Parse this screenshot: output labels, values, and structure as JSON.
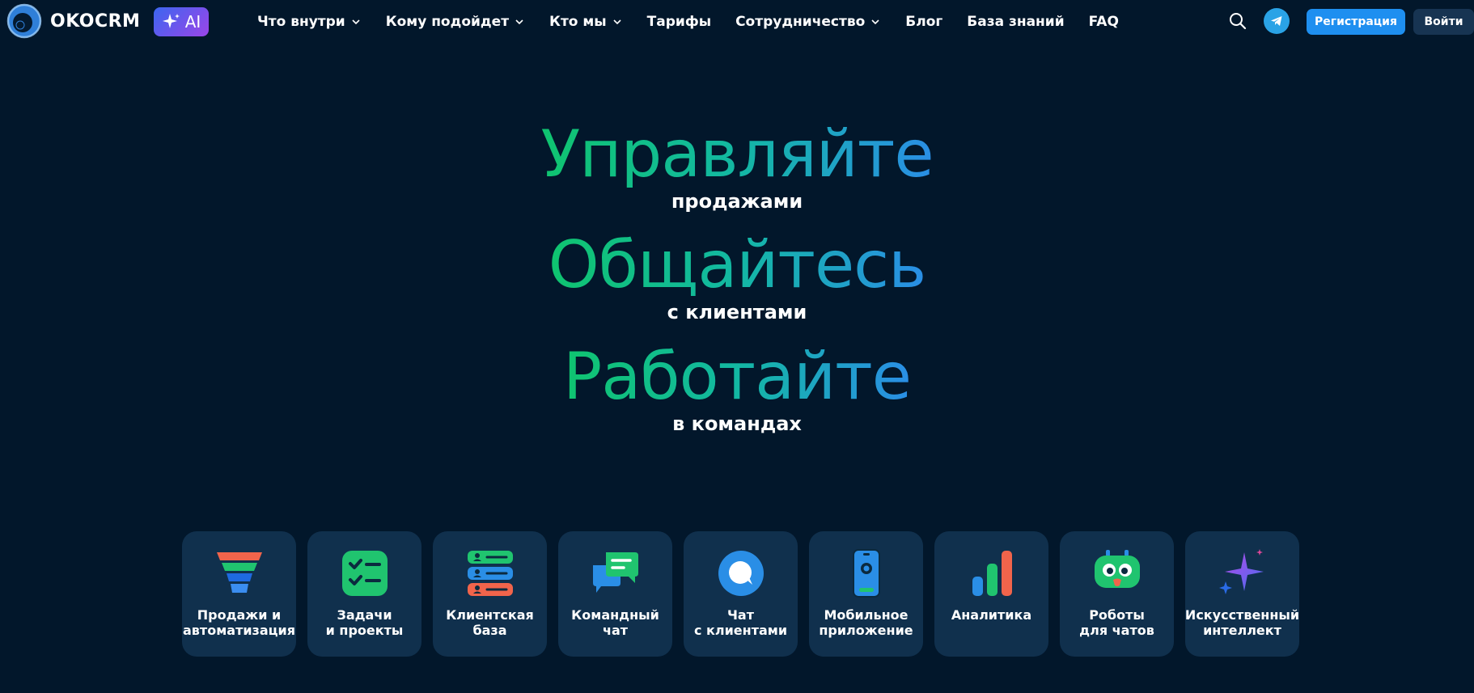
{
  "header": {
    "logo_text": "OKOCRM",
    "ai_badge": "AI",
    "nav": [
      {
        "label": "Что внутри",
        "dropdown": true
      },
      {
        "label": "Кому подойдет",
        "dropdown": true
      },
      {
        "label": "Кто мы",
        "dropdown": true
      },
      {
        "label": "Тарифы",
        "dropdown": false
      },
      {
        "label": "Сотрудничество",
        "dropdown": true
      },
      {
        "label": "Блог",
        "dropdown": false
      },
      {
        "label": "База знаний",
        "dropdown": false
      },
      {
        "label": "FAQ",
        "dropdown": false
      }
    ],
    "register_label": "Регистрация",
    "login_label": "Войти"
  },
  "hero": {
    "lines": [
      {
        "big": "Управляйте",
        "small": "продажами"
      },
      {
        "big": "Общайтесь",
        "small": "с клиентами"
      },
      {
        "big": "Работайте",
        "small": "в командах"
      }
    ]
  },
  "features": [
    {
      "icon": "funnel-icon",
      "line1": "Продажи и",
      "line2": "автоматизация"
    },
    {
      "icon": "checklist-icon",
      "line1": "Задачи",
      "line2": "и проекты"
    },
    {
      "icon": "contacts-icon",
      "line1": "Клиентская",
      "line2": "база"
    },
    {
      "icon": "team-chat-icon",
      "line1": "Командный",
      "line2": "чат"
    },
    {
      "icon": "chat-bubble-icon",
      "line1": "Чат",
      "line2": "с клиентами"
    },
    {
      "icon": "mobile-phone-icon",
      "line1": "Мобильное",
      "line2": "приложение"
    },
    {
      "icon": "bar-chart-icon",
      "line1": "Аналитика",
      "line2": ""
    },
    {
      "icon": "robot-icon",
      "line1": "Роботы",
      "line2": "для чатов"
    },
    {
      "icon": "sparkle-icon",
      "line1": "Искусственный",
      "line2": "интеллект"
    }
  ],
  "colors": {
    "background": "#02172b",
    "card": "#10304d",
    "accent_blue": "#1e8ff0",
    "gradient_green": "#0fc46f",
    "gradient_blue": "#2a8ee6"
  }
}
